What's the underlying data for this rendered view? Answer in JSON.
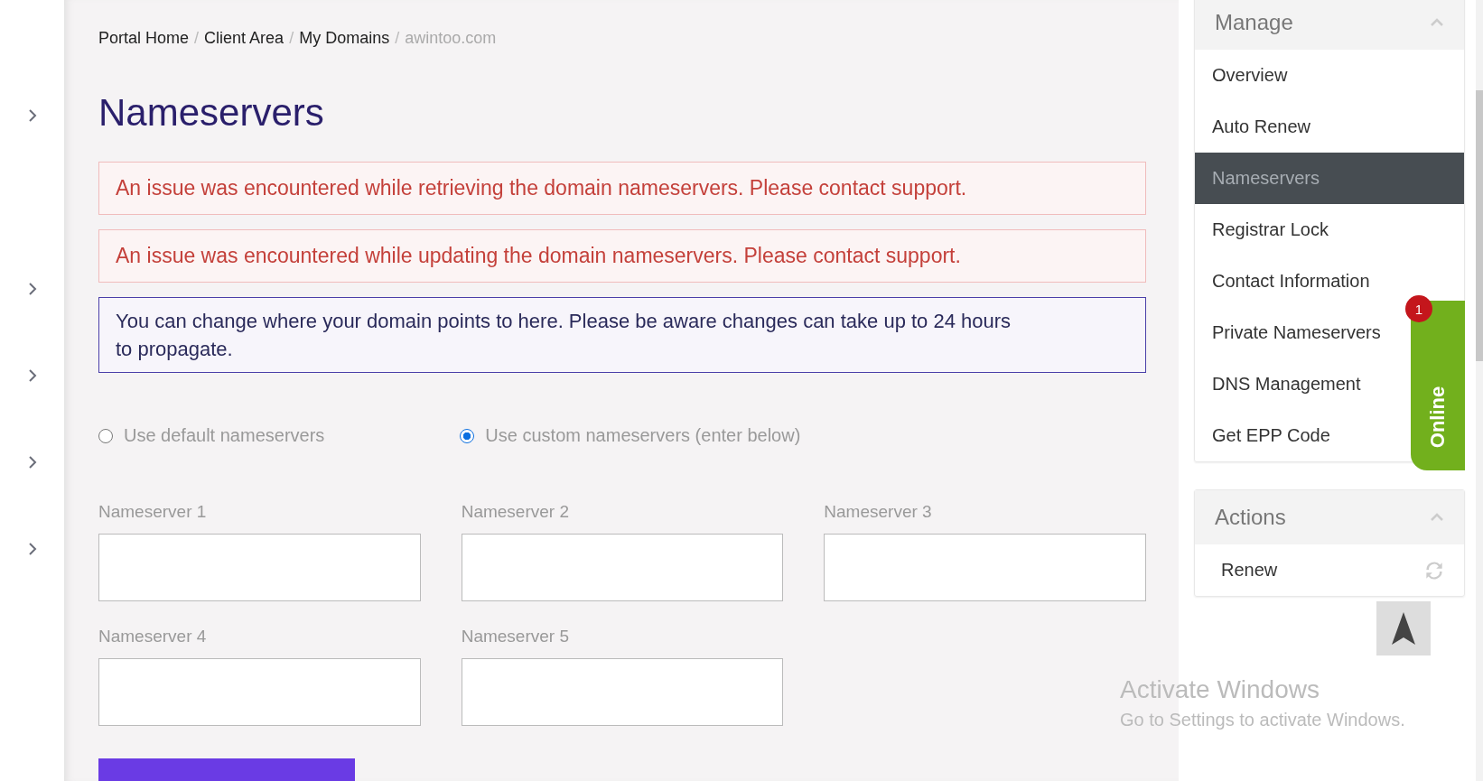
{
  "breadcrumb_separator": "/",
  "breadcrumb": [
    {
      "label": "Portal Home",
      "current": false
    },
    {
      "label": "Client Area",
      "current": false
    },
    {
      "label": "My Domains",
      "current": false
    },
    {
      "label": "awintoo.com",
      "current": true
    }
  ],
  "title": "Nameservers",
  "alerts": [
    {
      "kind": "error",
      "text": "An issue was encountered while retrieving the domain nameservers. Please contact support."
    },
    {
      "kind": "error",
      "text": "An issue was encountered while updating the domain nameservers. Please contact support."
    },
    {
      "kind": "info",
      "text": "You can change where your domain points to here. Please be aware changes can take up to 24 hours to propagate."
    }
  ],
  "options": [
    {
      "label": "Use default nameservers",
      "selected": false
    },
    {
      "label": "Use custom nameservers (enter below)",
      "selected": true
    }
  ],
  "fields": [
    {
      "label": "Nameserver 1"
    },
    {
      "label": "Nameserver 2"
    },
    {
      "label": "Nameserver 3"
    },
    {
      "label": "Nameserver 4"
    },
    {
      "label": "Nameserver 5"
    }
  ],
  "sidebar": [
    {
      "title": "Manage",
      "expanded": true,
      "items": [
        {
          "label": "Overview",
          "selected": false
        },
        {
          "label": "Auto Renew",
          "selected": false
        },
        {
          "label": "Nameservers",
          "selected": true
        },
        {
          "label": "Registrar Lock",
          "selected": false
        },
        {
          "label": "Contact Information",
          "selected": false
        },
        {
          "label": "Private Nameservers",
          "selected": false
        },
        {
          "label": "DNS Management",
          "selected": false
        },
        {
          "label": "Get EPP Code",
          "selected": false
        }
      ]
    },
    {
      "title": "Actions",
      "expanded": true,
      "items": [
        {
          "label": "Renew",
          "selected": false
        }
      ]
    }
  ],
  "chat_tab": {
    "label": "Online",
    "badge": "1"
  },
  "os_notice": {
    "title": "Activate Windows",
    "text": "Go to Settings to activate Windows."
  }
}
